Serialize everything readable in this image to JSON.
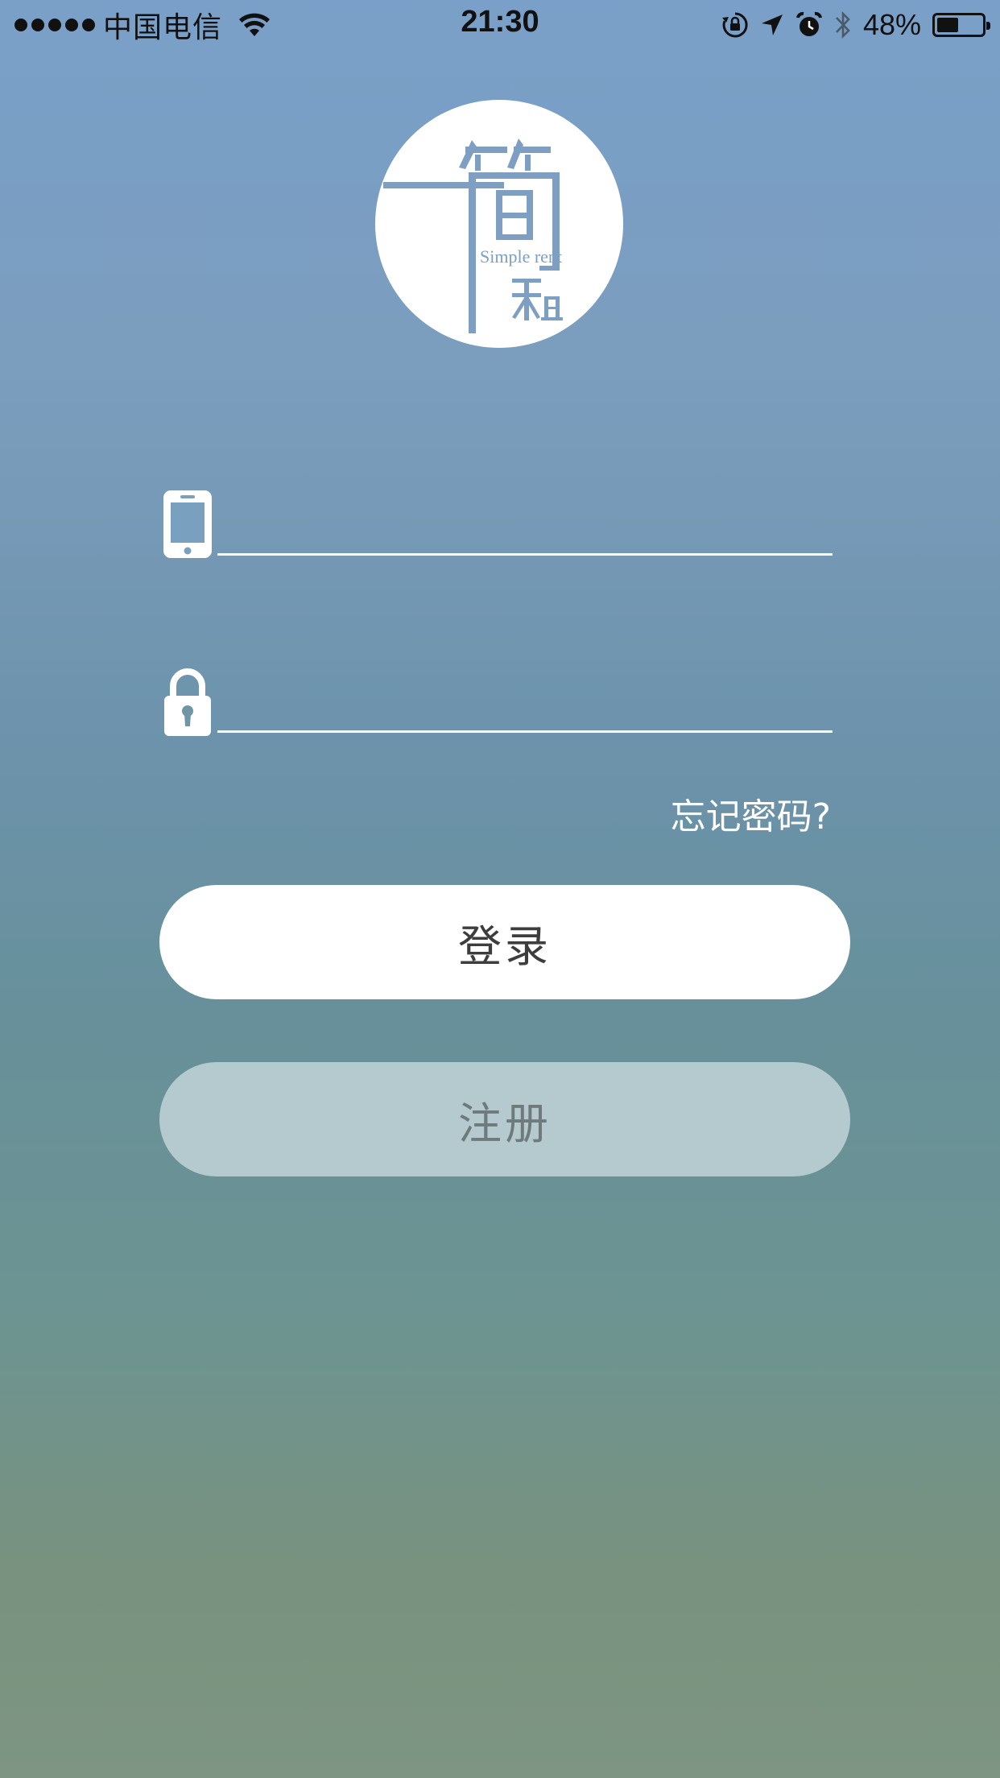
{
  "status_bar": {
    "carrier": "中国电信",
    "time": "21:30",
    "battery_percent": "48%",
    "battery_level": 0.48,
    "icons": [
      "signal-dots",
      "wifi-icon",
      "orientation-lock-icon",
      "location-arrow-icon",
      "alarm-icon",
      "bluetooth-icon",
      "battery-icon"
    ]
  },
  "logo": {
    "text": "Simple rent",
    "mark": "简租"
  },
  "form": {
    "phone_placeholder": "",
    "password_placeholder": "",
    "phone_icon": "phone-icon",
    "password_icon": "lock-icon",
    "forgot_password": "忘记密码?"
  },
  "buttons": {
    "login": "登录",
    "register": "注册"
  },
  "colors": {
    "gradient_top": "#7aa0c9",
    "gradient_mid": "#67909a",
    "gradient_bottom": "#7d9582",
    "logo_accent": "#7e9fc1",
    "login_text": "#3d3d3d",
    "register_text": "#6f7a7c"
  }
}
